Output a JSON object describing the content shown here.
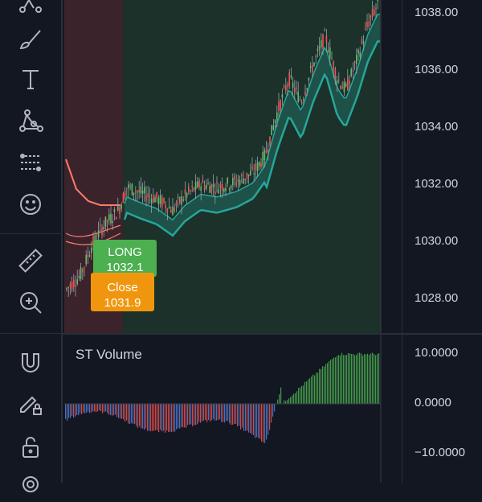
{
  "toolbar": {
    "tools": [
      {
        "name": "pattern-tool-icon"
      },
      {
        "name": "brush-icon"
      },
      {
        "name": "text-icon"
      },
      {
        "name": "xabcd-pattern-icon"
      },
      {
        "name": "forecast-icon"
      },
      {
        "name": "emoji-icon"
      },
      {
        "name": "ruler-icon"
      },
      {
        "name": "zoom-in-icon"
      },
      {
        "name": "magnet-icon"
      },
      {
        "name": "lock-drawing-icon"
      },
      {
        "name": "unlock-icon"
      },
      {
        "name": "eye-icon"
      }
    ]
  },
  "price_axis": {
    "labels": [
      "1038.00",
      "1036.00",
      "1034.00",
      "1032.00",
      "1030.00",
      "1028.00"
    ]
  },
  "volume_axis": {
    "labels": [
      "10.0000",
      "0.0000",
      "−10.0000"
    ]
  },
  "trades": {
    "long_label": "LONG",
    "long_price": "1032.1",
    "close_label": "Close",
    "close_price": "1031.9"
  },
  "volume_pane": {
    "title": "ST Volume"
  },
  "colors": {
    "background": "#131722",
    "bull": "#4caf50",
    "bear": "#ef5350",
    "band": "#26a69a",
    "long_zone": "#1f3b2c",
    "short_zone": "#4a2830",
    "close_tag": "#f0960e"
  }
}
